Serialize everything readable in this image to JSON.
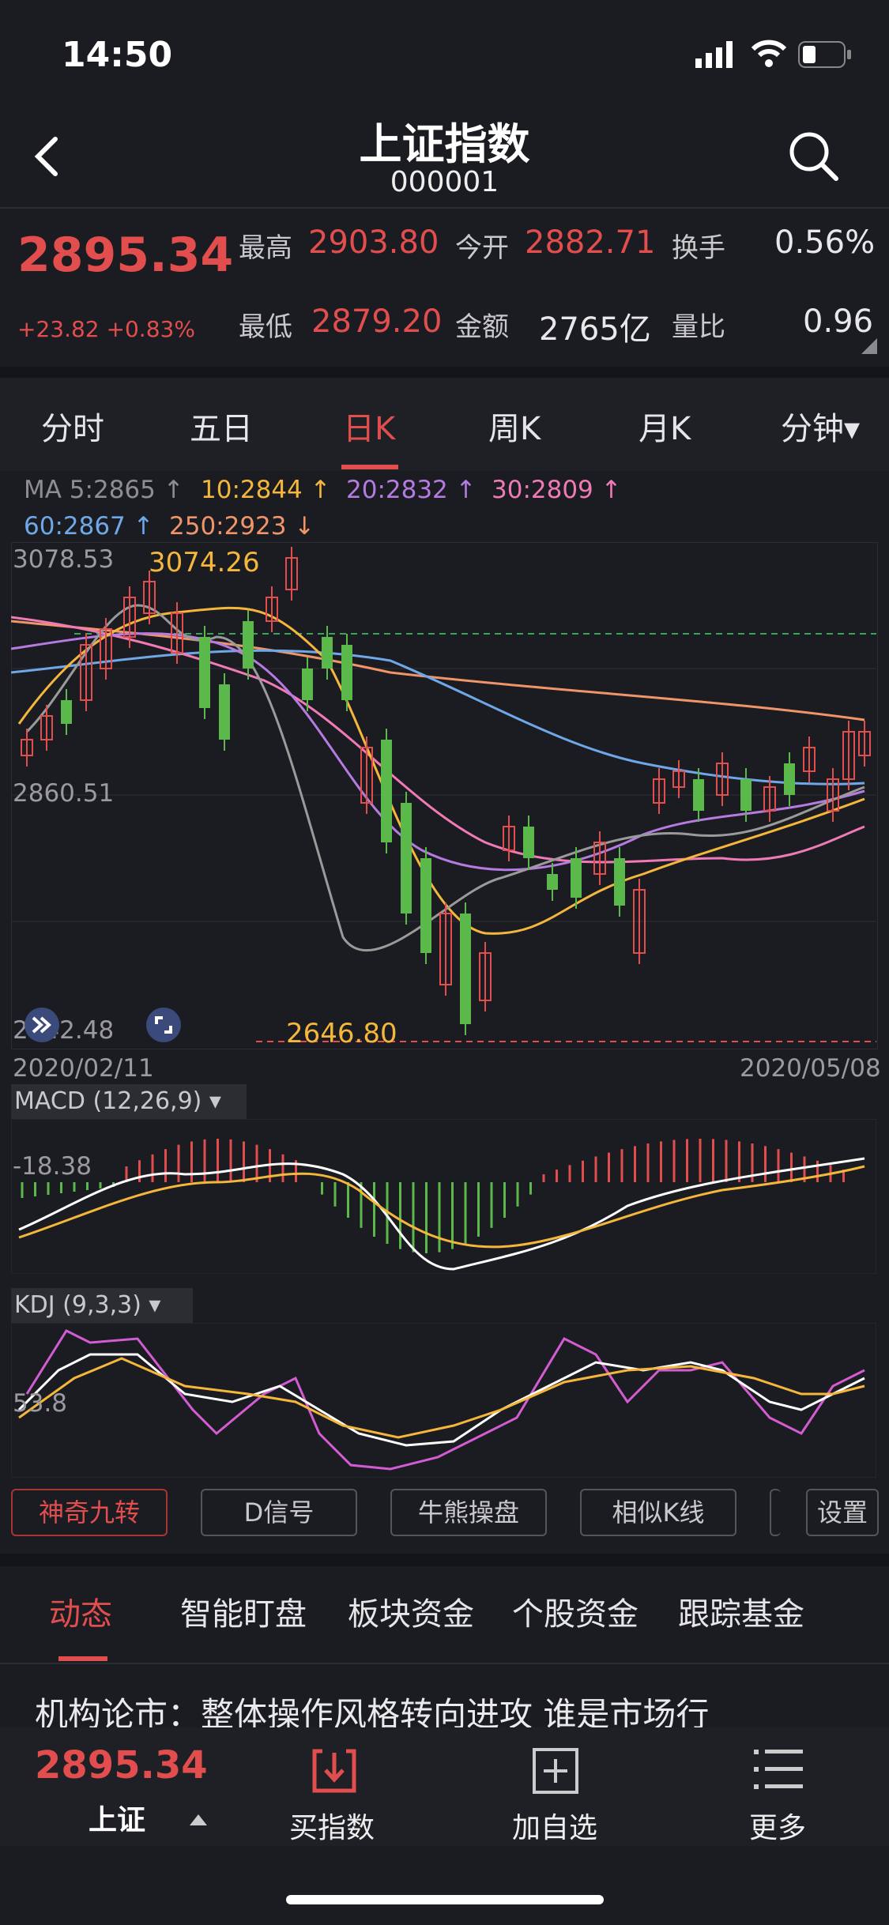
{
  "status": {
    "time": "14:50"
  },
  "header": {
    "title": "上证指数",
    "code": "000001"
  },
  "quote": {
    "price": "2895.34",
    "change": "+23.82 +0.83%",
    "fields": [
      {
        "label": "最高",
        "value": "2903.80"
      },
      {
        "label": "今开",
        "value": "2882.71"
      },
      {
        "label": "换手",
        "value": "0.56%"
      },
      {
        "label": "最低",
        "value": "2879.20"
      },
      {
        "label": "金额",
        "value": "2765亿"
      },
      {
        "label": "量比",
        "value": "0.96"
      }
    ]
  },
  "tabs": [
    {
      "label": "分时"
    },
    {
      "label": "五日"
    },
    {
      "label": "日K"
    },
    {
      "label": "周K"
    },
    {
      "label": "月K"
    },
    {
      "label": "分钟▾"
    }
  ],
  "ma_legend": {
    "ma5": "MA 5:2865 ↑",
    "ma10": "10:2844 ↑",
    "ma20": "20:2832 ↑",
    "ma30": "30:2809 ↑",
    "ma60": "60:2867 ↑",
    "ma250": "250:2923 ↓"
  },
  "colors": {
    "red": "#e24e4e",
    "green": "#5bb94b",
    "ma5": "#9a9a9a",
    "ma10": "#f5b73b",
    "ma20": "#b57be0",
    "ma30": "#f07ab6",
    "ma60": "#6fa8e8",
    "ma250": "#f0956a"
  },
  "chart_data": {
    "type": "candlestick",
    "y_top_label": "3078.53",
    "y_mid_label": "2860.51",
    "y_bottom_label": "2642.48",
    "high_marker": "3074.26",
    "low_marker": "2646.80",
    "x_start": "2020/02/11",
    "x_end": "2020/05/08",
    "ylim": [
      2642.48,
      3078.53
    ]
  },
  "macd": {
    "title": "MACD (12,26,9) ▾",
    "value_label": "-18.38"
  },
  "kdj": {
    "title": "KDJ (9,3,3) ▾",
    "value_label": "53.8"
  },
  "tools": [
    {
      "label": "神奇九转"
    },
    {
      "label": "D信号"
    },
    {
      "label": "牛熊操盘"
    },
    {
      "label": "相似K线"
    },
    {
      "label": "设置"
    }
  ],
  "feed_tabs": [
    {
      "label": "动态"
    },
    {
      "label": "智能盯盘"
    },
    {
      "label": "板块资金"
    },
    {
      "label": "个股资金"
    },
    {
      "label": "跟踪基金"
    }
  ],
  "headline": "机构论市：整体操作风格转向进攻 谁是市场行",
  "bottom_bar": {
    "price": "2895.34",
    "name": "上证",
    "buy": "买指数",
    "add": "加自选",
    "more": "更多"
  }
}
